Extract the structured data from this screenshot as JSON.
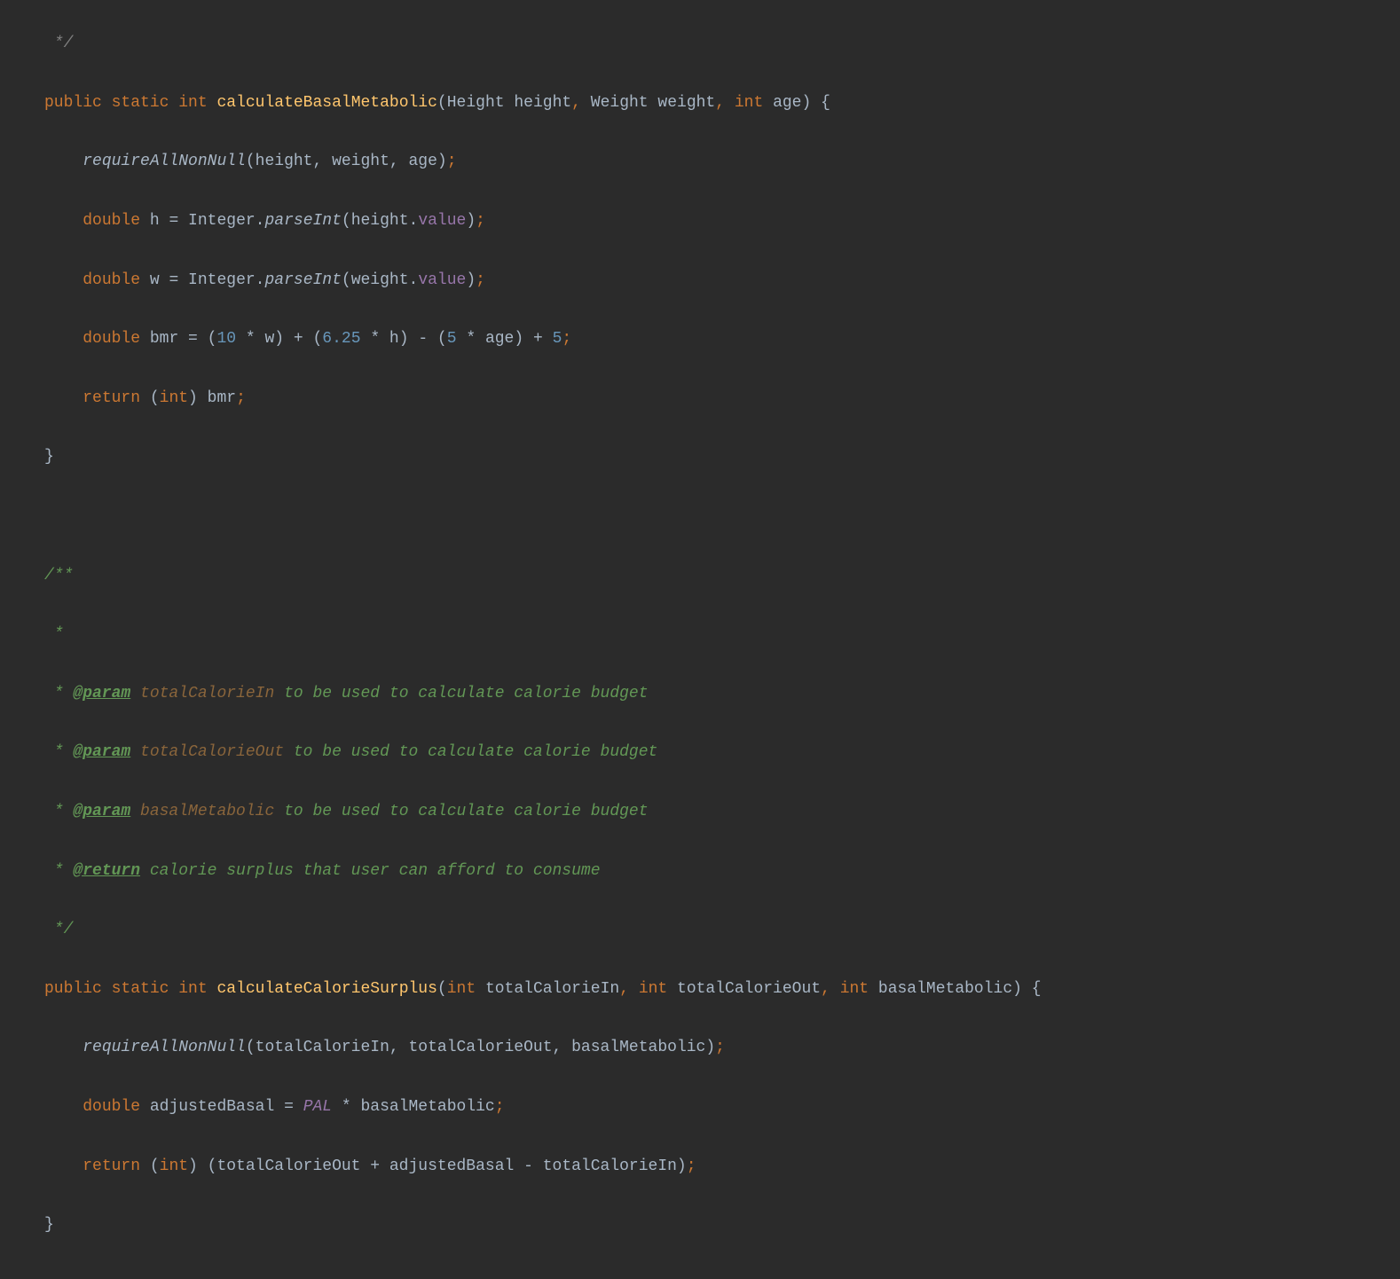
{
  "code": {
    "l0": " */",
    "m1": {
      "kw1": "public",
      "kw2": "static",
      "kw3": "int",
      "name": "calculateBasalMetabolic",
      "p1t": "Height",
      "p1n": "height",
      "p2t": "Weight",
      "p2n": "weight",
      "p3t": "int",
      "p3n": "age"
    },
    "b1": {
      "call": "requireAllNonNull",
      "args": "(height, weight, age)"
    },
    "b2": {
      "kw": "double",
      "var": "h",
      "eq": " = Integer.",
      "fn": "parseInt",
      "open": "(height.",
      "field": "value",
      "close": ")"
    },
    "b3": {
      "kw": "double",
      "var": "w",
      "eq": " = Integer.",
      "fn": "parseInt",
      "open": "(weight.",
      "field": "value",
      "close": ")"
    },
    "b4": {
      "kw": "double",
      "var": "bmr",
      "eq": " = (",
      "n1": "10",
      "t1": " * w) + (",
      "n2": "6.25",
      "t2": " * h) - (",
      "n3": "5",
      "t3": " * age) + ",
      "n4": "5"
    },
    "b5": {
      "kw1": "return",
      "t1": " (",
      "kw2": "int",
      "t2": ") bmr"
    },
    "doc": {
      "open": "/**",
      "star": " *",
      "tag": "@param",
      "p1": "totalCalorieIn",
      "p1desc": " to be used to calculate calorie budget",
      "p2": "totalCalorieOut",
      "p2desc": " to be used to calculate calorie budget",
      "p3": "basalMetabolic",
      "p3desc": " to be used to calculate calorie budget",
      "rtag": "@return",
      "rdesc": " calorie surplus that user can afford to consume",
      "close": " */"
    },
    "m2": {
      "kw1": "public",
      "kw2": "static",
      "kw3": "int",
      "name": "calculateCalorieSurplus",
      "pt": "int",
      "p1n": "totalCalorieIn",
      "p2n": "totalCalorieOut",
      "p3n": "basalMetabolic"
    },
    "c1": {
      "call": "requireAllNonNull",
      "args": "(totalCalorieIn, totalCalorieOut, basalMetabolic)"
    },
    "c2": {
      "kw": "double",
      "var": "adjustedBasal",
      "eq": " = ",
      "const": "PAL",
      "rest": " * basalMetabolic"
    },
    "c3": {
      "kw1": "return",
      "t1": " (",
      "kw2": "int",
      "t2": ") (totalCalorieOut + adjustedBasal - totalCalorieIn)"
    },
    "brace_open": " {",
    "brace_close": "}",
    "semi": ";"
  }
}
